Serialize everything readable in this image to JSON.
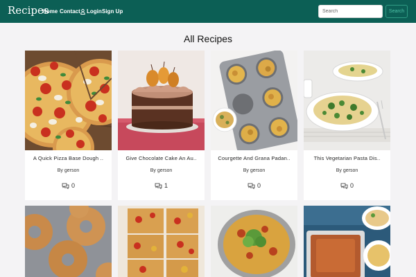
{
  "navbar": {
    "brand": "Recipes",
    "links": {
      "home": "Home",
      "contact": "Contact",
      "login": "Login",
      "signup": "Sign Up"
    },
    "search": {
      "placeholder": "Search",
      "button": "Search"
    },
    "colors": {
      "background": "#0c5f55",
      "search_button": "#4fc4a8"
    }
  },
  "page": {
    "title": "All Recipes"
  },
  "recipes": [
    {
      "title": "A Quick Pizza Base Dough ..",
      "author": "By gerson",
      "comments": "0"
    },
    {
      "title": "Give Chocolate Cake An Au..",
      "author": "By gerson",
      "comments": "1"
    },
    {
      "title": "Courgette And Grana Padan..",
      "author": "By gerson",
      "comments": "0"
    },
    {
      "title": "This Vegetarian Pasta Dis..",
      "author": "By gerson",
      "comments": "0"
    }
  ],
  "icons": {
    "login": "user-icon",
    "comments": "comments-icon"
  }
}
